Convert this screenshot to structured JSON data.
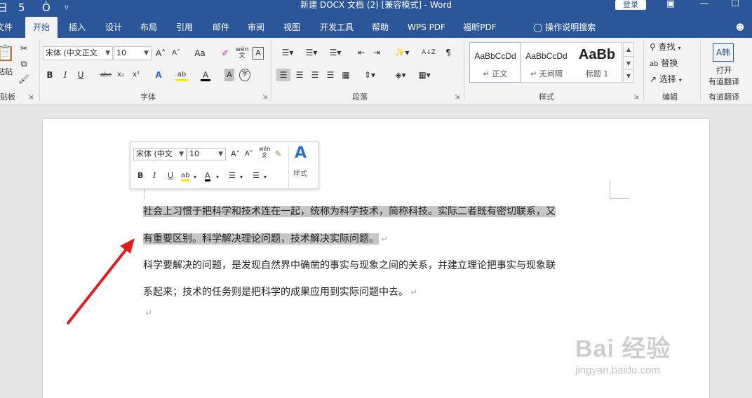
{
  "title_bar": {
    "title": "新建 DOCX 文档 (2) [兼容模式] - Word",
    "login_label": "登录",
    "save_glyph": "日",
    "undo_glyph": "5",
    "redo_glyph": "Ò",
    "customize_glyph": "▿",
    "ribbon_display_glyph": "▣",
    "minimize_glyph": "—",
    "maximize_glyph": "☐"
  },
  "tabs": [
    {
      "label": "文件"
    },
    {
      "label": "开始"
    },
    {
      "label": "插入"
    },
    {
      "label": "设计"
    },
    {
      "label": "布局"
    },
    {
      "label": "引用"
    },
    {
      "label": "邮件"
    },
    {
      "label": "审阅"
    },
    {
      "label": "视图"
    },
    {
      "label": "开发工具"
    },
    {
      "label": "帮助"
    },
    {
      "label": "WPS PDF"
    },
    {
      "label": "福昕PDF"
    }
  ],
  "tell_me": {
    "label": "操作说明搜索",
    "icon": "lightbulb-icon"
  },
  "share_icon": "share-person-icon",
  "ribbon": {
    "clipboard": {
      "paste_label": "粘贴",
      "group_label": "贴板"
    },
    "font": {
      "font_name": "宋体 (中文正文",
      "font_size": "10",
      "grow_glyph": "A˄",
      "shrink_glyph": "A˅",
      "case_label": "Aa",
      "clear_glyph": "✐",
      "phonetic_glyph": "wén 文",
      "border_char_glyph": "A",
      "bold": "B",
      "italic": "I",
      "underline": "U",
      "strike": "abc",
      "subscript": "x₂",
      "superscript": "x²",
      "effects_glyph": "A",
      "highlight_glyph": "ab",
      "color_glyph": "A",
      "shading_glyph": "A",
      "enclose_glyph": "字",
      "group_label": "字体"
    },
    "paragraph": {
      "group_label": "段落",
      "sort_glyph": "A↓Z",
      "marks_glyph": "¶"
    },
    "styles": {
      "group_label": "样式",
      "items": [
        {
          "sample": "AaBbCcDd",
          "name": "↵ 正文"
        },
        {
          "sample": "AaBbCcDd",
          "name": "↵ 无间隔"
        },
        {
          "sample": "AaBb",
          "name": "标题 1"
        }
      ]
    },
    "editing": {
      "find_label": "查找",
      "replace_label": "替换",
      "select_label": "选择",
      "group_label": "编辑"
    },
    "translate": {
      "open_label": "打开",
      "sub_label": "有道翻译",
      "group_label": "有道翻译"
    }
  },
  "mini_toolbar": {
    "font_name": "宋体 (中文",
    "font_size": "10",
    "grow_glyph": "A˄",
    "shrink_glyph": "A˅",
    "phonetic_glyph": "wén 文",
    "painter_glyph": "✎",
    "styles_glyph": "A",
    "styles_label": "样式",
    "bold": "B",
    "italic": "I",
    "underline": "U",
    "highlight_glyph": "ab",
    "color_glyph": "A",
    "bullets_glyph": "☰",
    "numbering_glyph": "☰"
  },
  "document": {
    "paragraphs": [
      {
        "line1": "社会上习惯于把科学和技术连在一起，统称为科学技术，简称科技。实际二者既有密切联系，又",
        "line2": "有重要区别。科学解决理论问题，技术解决实际问题。",
        "selected": true
      },
      {
        "line1": "科学要解决的问题，是发现自然界中确凿的事实与现象之间的关系，并建立理论把事实与现象联",
        "line2": "系起来；技术的任务则是把科学的成果应用到实际问题中去。",
        "selected": false
      }
    ],
    "para_mark": "↵"
  },
  "watermark": {
    "text": "Bai 经验",
    "url": "jingyan.baidu.com"
  },
  "colors": {
    "accent": "#2b579a",
    "arrow": "#e02020",
    "selection": "#c6c6c6"
  }
}
